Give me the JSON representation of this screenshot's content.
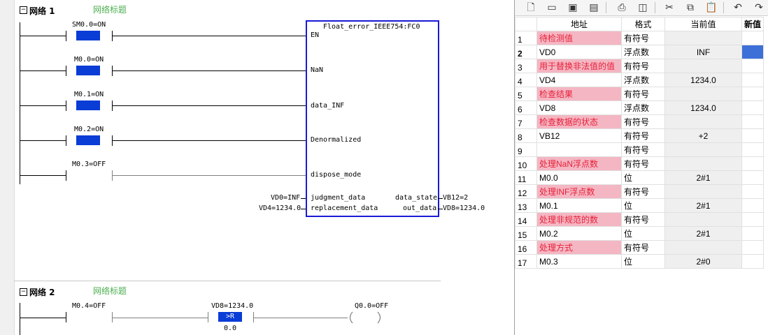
{
  "ladder": {
    "networks": [
      {
        "title": "网络 1",
        "subtitle": "网络标题"
      },
      {
        "title": "网络 2",
        "subtitle": "网络标题"
      }
    ],
    "contacts": [
      "SM0.0=ON",
      "M0.0=ON",
      "M0.1=ON",
      "M0.2=ON",
      "M0.3=OFF",
      "M0.4=OFF"
    ],
    "block": {
      "name": "Float_error_IEEE754:FC0",
      "inputs": [
        "EN",
        "NaN",
        "data_INF",
        "Denormalized",
        "dispose_mode",
        "judgment_data",
        "replacement_data"
      ],
      "outputs": [
        "data_state",
        "out_data"
      ],
      "in_values": [
        "VD0=INF",
        "VD4=1234.0"
      ],
      "out_values": [
        "VB12=2",
        "VD8=1234.0"
      ]
    },
    "compare": {
      "top": "VD8=1234.0",
      "op": ">R",
      "bottom": "0.0"
    },
    "coil": "Q0.0=OFF"
  },
  "toolbar": {
    "icons": [
      "new-icon",
      "open-icon",
      "save-icon",
      "save-all-icon",
      "print-icon",
      "preview-icon",
      "cut-icon",
      "copy-icon",
      "paste-icon",
      "undo-icon",
      "redo-icon"
    ]
  },
  "status_chart": {
    "headers": [
      "地址",
      "格式",
      "当前值",
      "新值"
    ],
    "rows": [
      {
        "n": "1",
        "addr": "待检测值",
        "fmt": "有符号",
        "cur": "",
        "comment": true
      },
      {
        "n": "2",
        "addr": "VD0",
        "fmt": "浮点数",
        "cur": "INF",
        "comment": false
      },
      {
        "n": "3",
        "addr": "用于替换非法值的值",
        "fmt": "有符号",
        "cur": "",
        "comment": true
      },
      {
        "n": "4",
        "addr": "VD4",
        "fmt": "浮点数",
        "cur": "1234.0",
        "comment": false
      },
      {
        "n": "5",
        "addr": "检查结果",
        "fmt": "有符号",
        "cur": "",
        "comment": true
      },
      {
        "n": "6",
        "addr": "VD8",
        "fmt": "浮点数",
        "cur": "1234.0",
        "comment": false
      },
      {
        "n": "7",
        "addr": "检查数据的状态",
        "fmt": "有符号",
        "cur": "",
        "comment": true
      },
      {
        "n": "8",
        "addr": "VB12",
        "fmt": "有符号",
        "cur": "+2",
        "comment": false
      },
      {
        "n": "9",
        "addr": "",
        "fmt": "有符号",
        "cur": "",
        "comment": false
      },
      {
        "n": "10",
        "addr": "处理NaN浮点数",
        "fmt": "有符号",
        "cur": "",
        "comment": true
      },
      {
        "n": "11",
        "addr": "M0.0",
        "fmt": "位",
        "cur": "2#1",
        "comment": false
      },
      {
        "n": "12",
        "addr": "处理INF浮点数",
        "fmt": "有符号",
        "cur": "",
        "comment": true
      },
      {
        "n": "13",
        "addr": "M0.1",
        "fmt": "位",
        "cur": "2#1",
        "comment": false
      },
      {
        "n": "14",
        "addr": "处理非规范的数",
        "fmt": "有符号",
        "cur": "",
        "comment": true
      },
      {
        "n": "15",
        "addr": "M0.2",
        "fmt": "位",
        "cur": "2#1",
        "comment": false
      },
      {
        "n": "16",
        "addr": "处理方式",
        "fmt": "有符号",
        "cur": "",
        "comment": true
      },
      {
        "n": "17",
        "addr": "M0.3",
        "fmt": "位",
        "cur": "2#0",
        "comment": false
      }
    ]
  }
}
